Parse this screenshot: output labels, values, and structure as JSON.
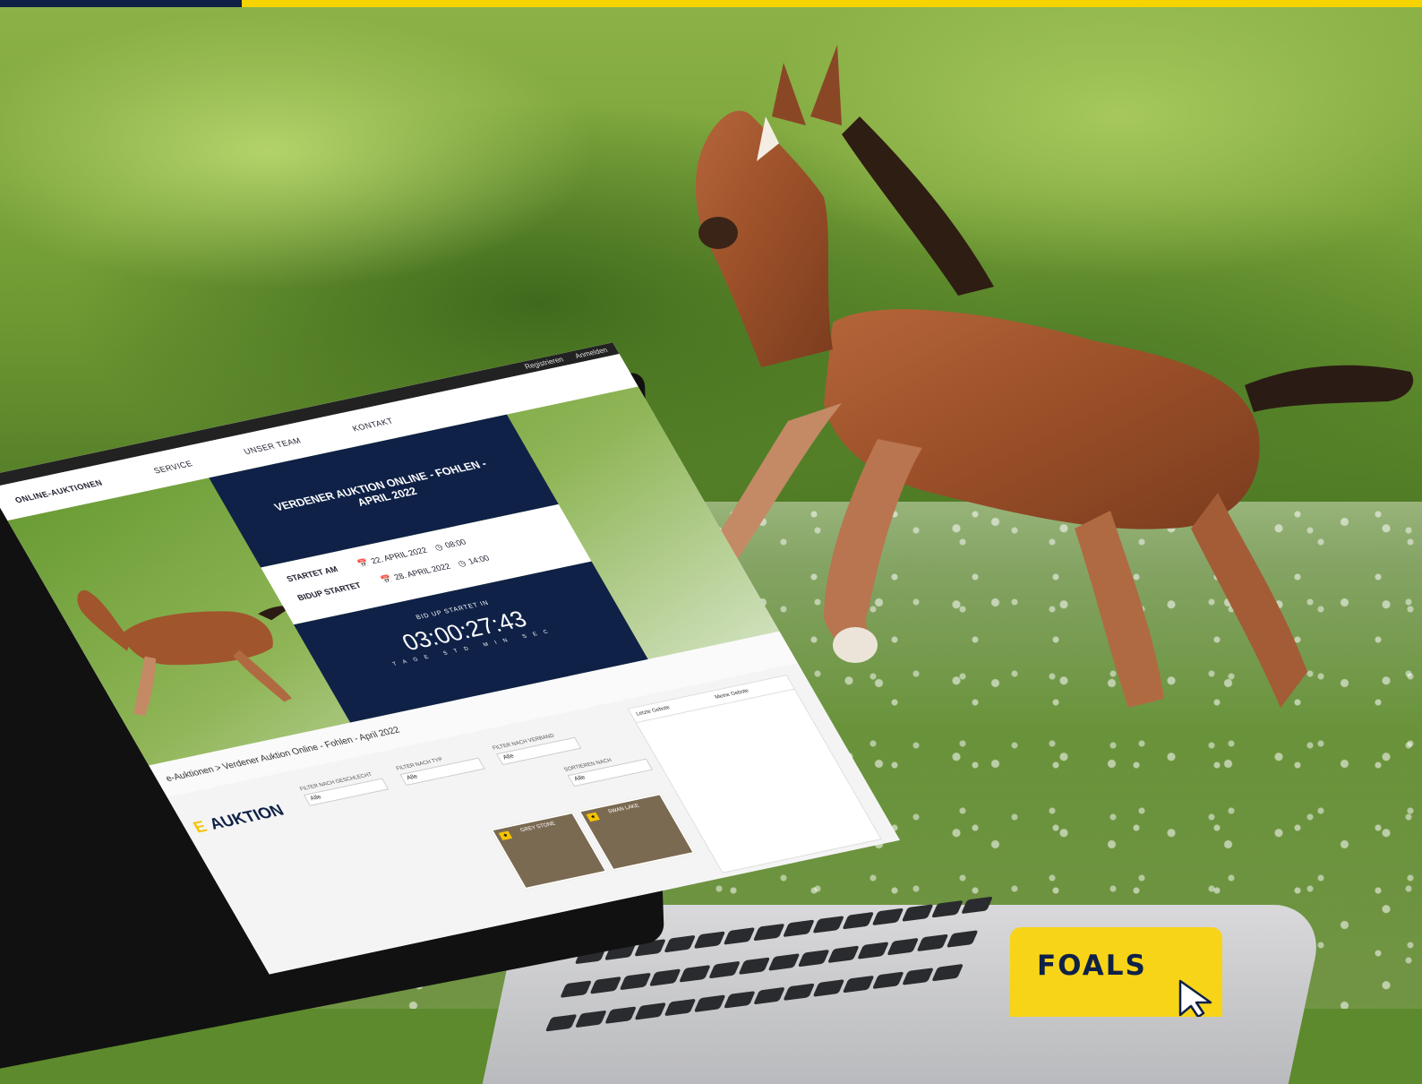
{
  "screen": {
    "top_links": [
      "Registrieren",
      "Anmelden"
    ],
    "nav": [
      "ONLINE-AUKTIONEN",
      "SERVICE",
      "UNSER TEAM",
      "KONTAKT"
    ],
    "auction_title": "VERDENER AUKTION ONLINE - FOHLEN - APRIL 2022",
    "starts_label": "STARTET AM",
    "starts_date": "22. APRIL 2022",
    "starts_time": "08:00",
    "bidup_label": "BIDUP STARTET",
    "bidup_date": "28. APRIL 2022",
    "bidup_time": "14:00",
    "countdown_label": "BID UP STARTET IN",
    "countdown": "03:00:27:43",
    "countdown_units": "TAGE STD MIN SEC",
    "breadcrumb": "e-Auktionen > Verdener Auktion Online - Fohlen - April 2022",
    "heading_prefix": "E",
    "heading": "AUKTION",
    "filters": [
      {
        "label": "FILTER NACH GESCHLECHT",
        "value": "Alle"
      },
      {
        "label": "FILTER NACH TYP",
        "value": "Alle"
      },
      {
        "label": "FILTER NACH VERBAND",
        "value": "Alle"
      },
      {
        "label": "SORTIEREN NACH",
        "value": "Alle"
      }
    ],
    "cards": [
      "GREY STONE",
      "SWAN LAKE"
    ],
    "side_tabs": [
      "Letzte Gebote",
      "Meine Gebote"
    ]
  },
  "badge": {
    "label": "FOALS",
    "icon": "cursor-arrow-icon",
    "color": "#f7d417"
  },
  "colors": {
    "navy": "#0f2147",
    "yellow": "#f6d400"
  }
}
